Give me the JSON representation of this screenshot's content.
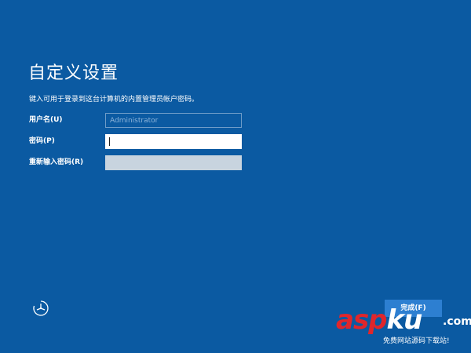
{
  "page": {
    "title": "自定义设置",
    "description": "键入可用于登录到这台计算机的内置管理员帐户密码。"
  },
  "form": {
    "username": {
      "label": "用户名(U)",
      "placeholder": "Administrator"
    },
    "password": {
      "label": "密码(P)",
      "value": ""
    },
    "confirm_password": {
      "label": "重新输入密码(R)",
      "value": ""
    }
  },
  "footer": {
    "ease_of_access_icon": "ease-of-access-icon",
    "finish_label": "完成(F)"
  },
  "watermark": {
    "brand_red": "asp",
    "brand_white": "ku",
    "brand_suffix": ".com",
    "tagline": "免费网站源码下载站!"
  },
  "colors": {
    "background": "#0b5aa2",
    "button": "#2d7fd1",
    "watermark_red": "#e0262b"
  }
}
